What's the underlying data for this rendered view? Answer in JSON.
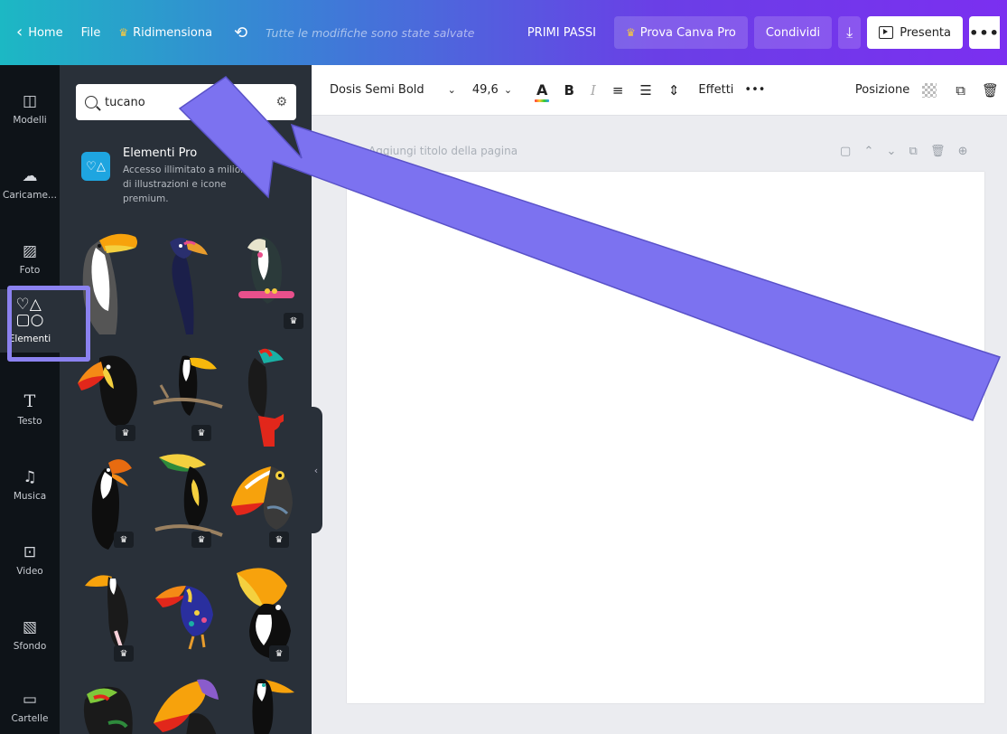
{
  "topbar": {
    "home": "Home",
    "file": "File",
    "resize": "Ridimensiona",
    "saved_status": "Tutte le modifiche sono state salvate",
    "getting_started": "PRIMI PASSI",
    "try_pro": "Prova Canva Pro",
    "share": "Condividi",
    "present": "Presenta"
  },
  "rail": {
    "items": [
      {
        "label": "Modelli",
        "icon": "template-icon"
      },
      {
        "label": "Caricame...",
        "icon": "upload-icon"
      },
      {
        "label": "Foto",
        "icon": "photo-icon"
      },
      {
        "label": "Elementi",
        "icon": "elements-icon"
      },
      {
        "label": "Testo",
        "icon": "text-icon"
      },
      {
        "label": "Musica",
        "icon": "music-icon"
      },
      {
        "label": "Video",
        "icon": "video-icon"
      },
      {
        "label": "Sfondo",
        "icon": "background-icon"
      },
      {
        "label": "Cartelle",
        "icon": "folder-icon"
      }
    ],
    "active_index": 3
  },
  "panel": {
    "search_value": "tucano",
    "pro_title": "Elementi Pro",
    "pro_desc": "Accesso illimitato a milioni di illustrazioni e icone premium."
  },
  "toolbar": {
    "font": "Dosis Semi Bold",
    "size": "49,6",
    "bold": "B",
    "italic": "I",
    "effects": "Effetti",
    "more": "•••",
    "position": "Posizione"
  },
  "canvas": {
    "page_title_placeholder": "Aggiungi titolo della pagina"
  },
  "colors": {
    "accent": "#8b82f0",
    "panel_bg": "#293039",
    "rail_bg": "#0e1318"
  }
}
